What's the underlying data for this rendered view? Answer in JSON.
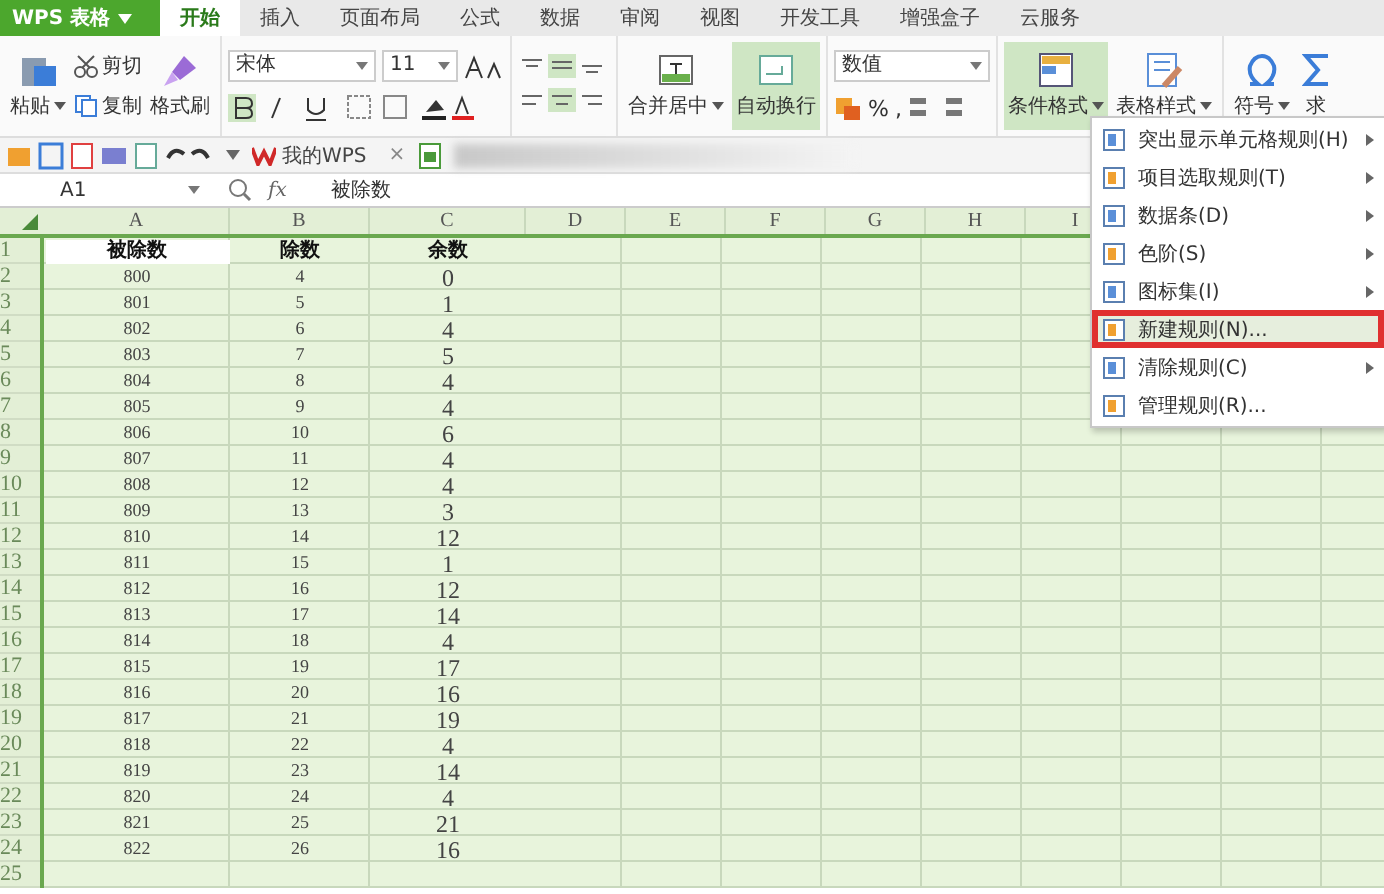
{
  "app_button": {
    "label": "WPS 表格"
  },
  "tabs": [
    {
      "label": "开始",
      "selected": true
    },
    {
      "label": "插入",
      "selected": false
    },
    {
      "label": "页面布局",
      "selected": false
    },
    {
      "label": "公式",
      "selected": false
    },
    {
      "label": "数据",
      "selected": false
    },
    {
      "label": "审阅",
      "selected": false
    },
    {
      "label": "视图",
      "selected": false
    },
    {
      "label": "开发工具",
      "selected": false
    },
    {
      "label": "增强盒子",
      "selected": false
    },
    {
      "label": "云服务",
      "selected": false
    }
  ],
  "ribbon": {
    "paste": "粘贴",
    "cut": "剪切",
    "copy": "复制",
    "format_painter": "格式刷",
    "font": "宋体",
    "font_size": "11",
    "merge": "合并居中",
    "wrap": {
      "label": "自动换行",
      "selected": true
    },
    "number_format": "数值",
    "percent": "%",
    "comma": ",",
    "conditional_format": {
      "label": "条件格式",
      "selected": true
    },
    "table_style": "表格样式",
    "symbol": "符号",
    "sum": "求"
  },
  "doc_tab": {
    "label": "我的WPS",
    "close": "×"
  },
  "formula_bar": {
    "cell": "A1",
    "fx": "fx",
    "value": "被除数"
  },
  "sheet": {
    "columns": [
      "A",
      "B",
      "C",
      "D",
      "E",
      "F",
      "G",
      "H",
      "I"
    ],
    "row_headers": [
      "1",
      "2",
      "3",
      "4",
      "5",
      "6",
      "7",
      "8",
      "9",
      "10",
      "11",
      "12",
      "13",
      "14",
      "15",
      "16",
      "17",
      "18",
      "19",
      "20",
      "21",
      "22",
      "23",
      "24",
      "25"
    ],
    "rows": [
      [
        "被除数",
        "除数",
        "余数"
      ],
      [
        "800",
        "4",
        "0"
      ],
      [
        "801",
        "5",
        "1"
      ],
      [
        "802",
        "6",
        "4"
      ],
      [
        "803",
        "7",
        "5"
      ],
      [
        "804",
        "8",
        "4"
      ],
      [
        "805",
        "9",
        "4"
      ],
      [
        "806",
        "10",
        "6"
      ],
      [
        "807",
        "11",
        "4"
      ],
      [
        "808",
        "12",
        "4"
      ],
      [
        "809",
        "13",
        "3"
      ],
      [
        "810",
        "14",
        "12"
      ],
      [
        "811",
        "15",
        "1"
      ],
      [
        "812",
        "16",
        "12"
      ],
      [
        "813",
        "17",
        "14"
      ],
      [
        "814",
        "18",
        "4"
      ],
      [
        "815",
        "19",
        "17"
      ],
      [
        "816",
        "20",
        "16"
      ],
      [
        "817",
        "21",
        "19"
      ],
      [
        "818",
        "22",
        "4"
      ],
      [
        "819",
        "23",
        "14"
      ],
      [
        "820",
        "24",
        "4"
      ],
      [
        "821",
        "25",
        "21"
      ],
      [
        "822",
        "26",
        "16"
      ],
      []
    ]
  },
  "menu": [
    {
      "label": "突出显示单元格规则(H)",
      "submenu": true,
      "selected": false
    },
    {
      "label": "项目选取规则(T)",
      "submenu": true,
      "selected": false
    },
    {
      "label": "数据条(D)",
      "submenu": true,
      "selected": false
    },
    {
      "label": "色阶(S)",
      "submenu": true,
      "selected": false
    },
    {
      "label": "图标集(I)",
      "submenu": true,
      "selected": false
    },
    {
      "label": "新建规则(N)...",
      "submenu": false,
      "selected": true
    },
    {
      "label": "清除规则(C)",
      "submenu": true,
      "selected": false
    },
    {
      "label": "管理规则(R)...",
      "submenu": false,
      "selected": false
    }
  ]
}
